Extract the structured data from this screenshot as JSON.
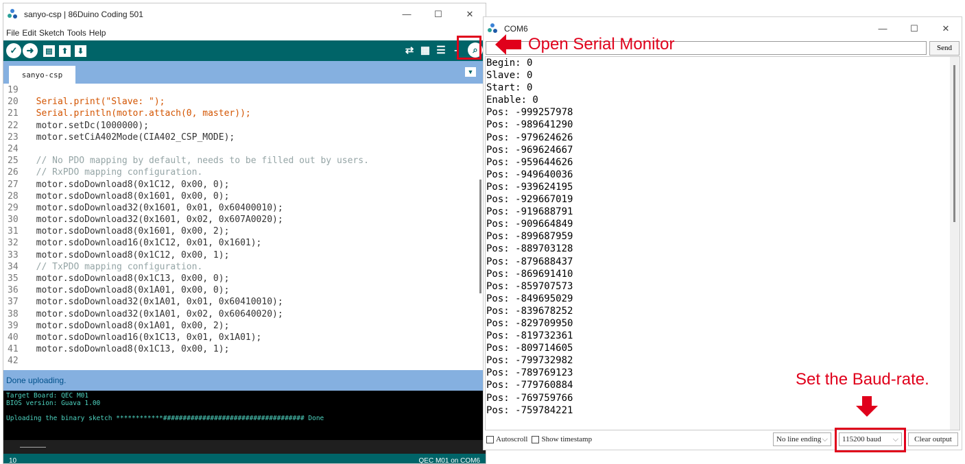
{
  "ide": {
    "title": "sanyo-csp | 86Duino Coding 501",
    "menu": [
      "File",
      "Edit",
      "Sketch",
      "Tools",
      "Help"
    ],
    "tab": "sanyo-csp",
    "code": [
      {
        "n": "19",
        "t": ""
      },
      {
        "n": "20",
        "t": "  Serial.print(\"Slave: \");",
        "kind": "print"
      },
      {
        "n": "21",
        "t": "  Serial.println(motor.attach(0, master));",
        "kind": "println"
      },
      {
        "n": "22",
        "t": "  motor.setDc(1000000);"
      },
      {
        "n": "23",
        "t": "  motor.setCiA402Mode(CIA402_CSP_MODE);"
      },
      {
        "n": "24",
        "t": ""
      },
      {
        "n": "25",
        "t": "  // No PDO mapping by default, needs to be filled out by users.",
        "kind": "comment"
      },
      {
        "n": "26",
        "t": "  // RxPDO mapping configuration.",
        "kind": "comment"
      },
      {
        "n": "27",
        "t": "  motor.sdoDownload8(0x1C12, 0x00, 0);"
      },
      {
        "n": "28",
        "t": "  motor.sdoDownload8(0x1601, 0x00, 0);"
      },
      {
        "n": "29",
        "t": "  motor.sdoDownload32(0x1601, 0x01, 0x60400010);"
      },
      {
        "n": "30",
        "t": "  motor.sdoDownload32(0x1601, 0x02, 0x607A0020);"
      },
      {
        "n": "31",
        "t": "  motor.sdoDownload8(0x1601, 0x00, 2);"
      },
      {
        "n": "32",
        "t": "  motor.sdoDownload16(0x1C12, 0x01, 0x1601);"
      },
      {
        "n": "33",
        "t": "  motor.sdoDownload8(0x1C12, 0x00, 1);"
      },
      {
        "n": "34",
        "t": "  // TxPDO mapping configuration.",
        "kind": "comment"
      },
      {
        "n": "35",
        "t": "  motor.sdoDownload8(0x1C13, 0x00, 0);"
      },
      {
        "n": "36",
        "t": "  motor.sdoDownload8(0x1A01, 0x00, 0);"
      },
      {
        "n": "37",
        "t": "  motor.sdoDownload32(0x1A01, 0x01, 0x60410010);"
      },
      {
        "n": "38",
        "t": "  motor.sdoDownload32(0x1A01, 0x02, 0x60640020);"
      },
      {
        "n": "39",
        "t": "  motor.sdoDownload8(0x1A01, 0x00, 2);"
      },
      {
        "n": "40",
        "t": "  motor.sdoDownload16(0x1C13, 0x01, 0x1A01);"
      },
      {
        "n": "41",
        "t": "  motor.sdoDownload8(0x1C13, 0x00, 1);"
      },
      {
        "n": "42",
        "t": ""
      }
    ],
    "status": "Done uploading.",
    "console": [
      "Target Board: QEC M01",
      "BIOS version: Guava 1.00",
      "",
      "Uploading the binary sketch ************#################################### Done"
    ],
    "footer_left": "10",
    "footer_right": "QEC M01 on COM6",
    "colors": {
      "teal": "#006468",
      "tabbar": "#85b0e0",
      "console_text": "#4ed3c0"
    }
  },
  "annotations": {
    "open_serial": "Open Serial Monitor",
    "set_baud": "Set the Baud-rate.",
    "color": "#e0001b"
  },
  "com": {
    "title": "COM6",
    "send": "Send",
    "output": [
      "Begin: 0",
      "Slave: 0",
      "Start: 0",
      "Enable: 0",
      "Pos: -999257978",
      "Pos: -989641290",
      "Pos: -979624626",
      "Pos: -969624667",
      "Pos: -959644626",
      "Pos: -949640036",
      "Pos: -939624195",
      "Pos: -929667019",
      "Pos: -919688791",
      "Pos: -909664849",
      "Pos: -899687959",
      "Pos: -889703128",
      "Pos: -879688437",
      "Pos: -869691410",
      "Pos: -859707573",
      "Pos: -849695029",
      "Pos: -839678252",
      "Pos: -829709950",
      "Pos: -819732361",
      "Pos: -809714605",
      "Pos: -799732982",
      "Pos: -789769123",
      "Pos: -779760884",
      "Pos: -769759766",
      "Pos: -759784221"
    ],
    "autoscroll": "Autoscroll",
    "timestamp": "Show timestamp",
    "line_ending": "No line ending",
    "baud": "115200 baud",
    "clear": "Clear output"
  }
}
